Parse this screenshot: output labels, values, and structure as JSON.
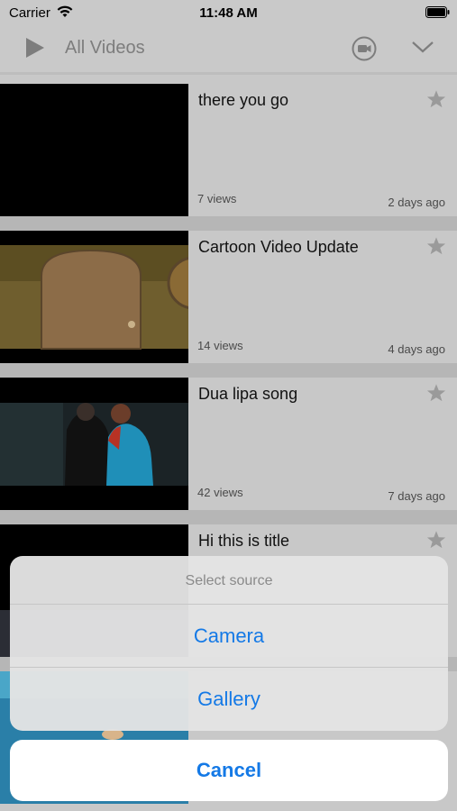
{
  "status_bar": {
    "carrier": "Carrier",
    "time": "11:48 AM"
  },
  "nav_bar": {
    "title": "All Videos",
    "icons": [
      "play-icon",
      "video-camera-icon",
      "chevron-down-icon"
    ]
  },
  "videos": [
    {
      "title": "there you go",
      "views": "7 views",
      "date": "2 days ago"
    },
    {
      "title": "Cartoon Video Update",
      "views": "14 views",
      "date": "4 days ago"
    },
    {
      "title": "Dua lipa song",
      "views": "42 views",
      "date": "7 days ago"
    },
    {
      "title": "Hi this is title",
      "views": "",
      "date": ""
    }
  ],
  "action_sheet": {
    "title": "Select source",
    "options": [
      "Camera",
      "Gallery"
    ],
    "cancel": "Cancel"
  },
  "colors": {
    "accent": "#1479e6",
    "background": "#c8c8c8"
  }
}
